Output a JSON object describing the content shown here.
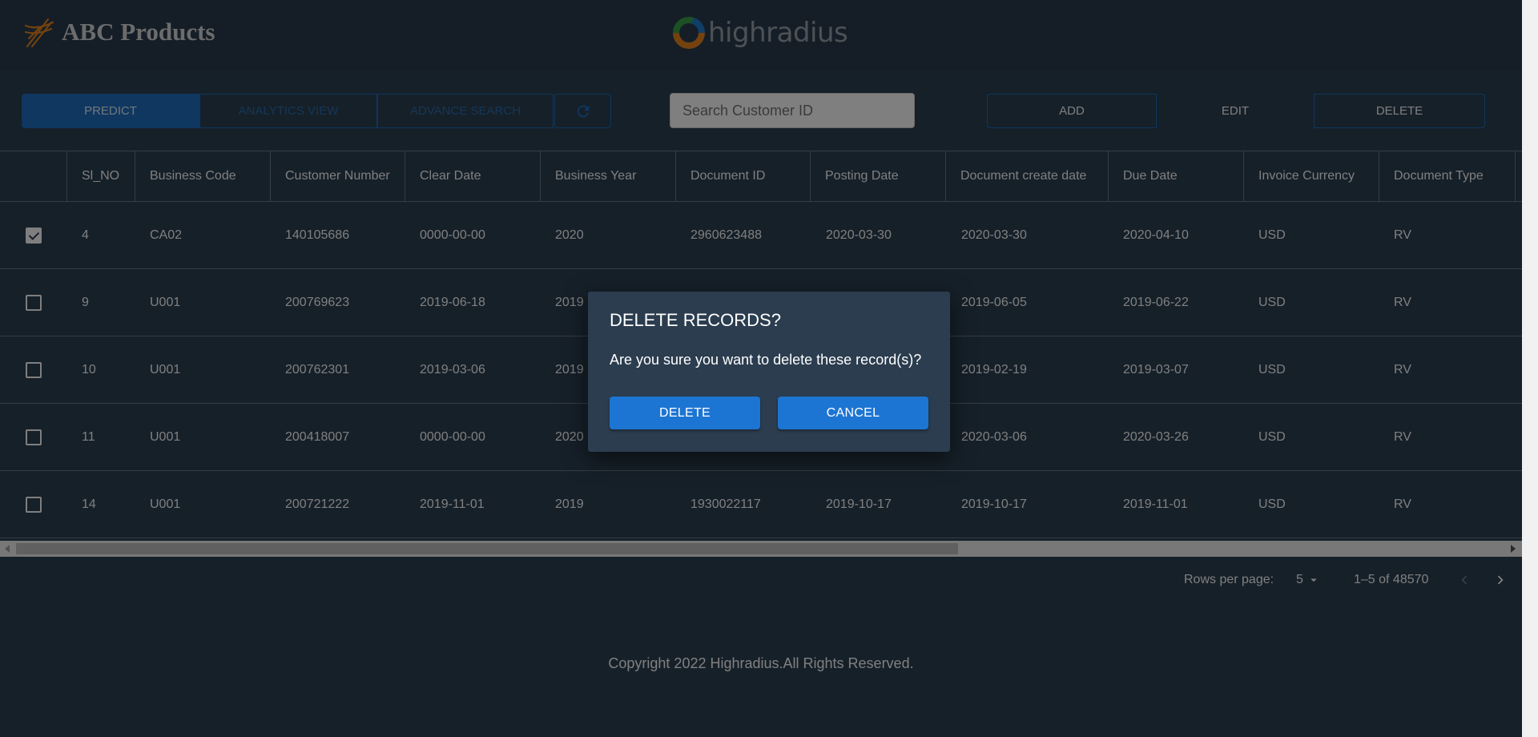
{
  "header": {
    "brand": "ABC Products",
    "partner_logo_text": "highradius"
  },
  "toolbar": {
    "predict": "PREDICT",
    "analytics_view": "ANALYTICS VIEW",
    "advance_search": "ADVANCE SEARCH",
    "search_placeholder": "Search Customer ID",
    "add": "ADD",
    "edit": "EDIT",
    "delete": "DELETE"
  },
  "table": {
    "columns": [
      "Sl_NO",
      "Business Code",
      "Customer Number",
      "Clear Date",
      "Business Year",
      "Document ID",
      "Posting Date",
      "Document create date",
      "Due Date",
      "Invoice Currency",
      "Document Type"
    ],
    "rows": [
      {
        "checked": true,
        "cells": [
          "4",
          "CA02",
          "140105686",
          "0000-00-00",
          "2020",
          "2960623488",
          "2020-03-30",
          "2020-03-30",
          "2020-04-10",
          "USD",
          "RV"
        ]
      },
      {
        "checked": false,
        "cells": [
          "9",
          "U001",
          "200769623",
          "2019-06-18",
          "2019",
          "",
          "",
          "2019-06-05",
          "2019-06-22",
          "USD",
          "RV"
        ]
      },
      {
        "checked": false,
        "cells": [
          "10",
          "U001",
          "200762301",
          "2019-03-06",
          "2019",
          "",
          "",
          "2019-02-19",
          "2019-03-07",
          "USD",
          "RV"
        ]
      },
      {
        "checked": false,
        "cells": [
          "11",
          "U001",
          "200418007",
          "0000-00-00",
          "2020",
          "",
          "",
          "2020-03-06",
          "2020-03-26",
          "USD",
          "RV"
        ]
      },
      {
        "checked": false,
        "cells": [
          "14",
          "U001",
          "200721222",
          "2019-11-01",
          "2019",
          "1930022117",
          "2019-10-17",
          "2019-10-17",
          "2019-11-01",
          "USD",
          "RV"
        ]
      }
    ]
  },
  "pagination": {
    "rows_per_page_label": "Rows per page:",
    "rows_per_page_value": "5",
    "range": "1–5 of 48570"
  },
  "footer": {
    "copyright": "Copyright 2022 Highradius.All Rights Reserved."
  },
  "dialog": {
    "title": "DELETE RECORDS?",
    "message": "Are you sure you want to delete these record(s)?",
    "confirm": "DELETE",
    "cancel": "CANCEL"
  },
  "colors": {
    "page_bg": "#2c4053",
    "accent_blue": "#1d75d3",
    "brand_orange": "#e8841d"
  }
}
